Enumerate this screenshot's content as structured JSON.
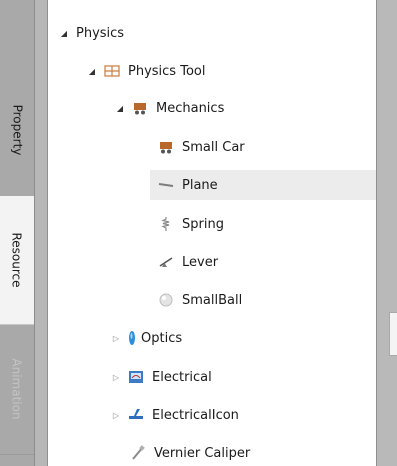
{
  "tabs": {
    "property": "Property",
    "resource": "Resource",
    "animation": "Animation"
  },
  "tree": {
    "physics": "Physics",
    "physics_tool": "Physics Tool",
    "mechanics": "Mechanics",
    "small_car": "Small Car",
    "plane": "Plane",
    "spring": "Spring",
    "lever": "Lever",
    "small_ball": "SmallBall",
    "optics": "Optics",
    "electrical": "Electrical",
    "electrical_icon": "ElectricalIcon",
    "vernier_caliper": "Vernier Caliper"
  },
  "selected_item": "Plane",
  "colors": {
    "tab_strip": "#a9a9a9",
    "active_tab": "#f3f3f3",
    "selection": "#ececec",
    "mechanics_icon": "#b8682a",
    "optics_icon": "#2e8fd9"
  }
}
